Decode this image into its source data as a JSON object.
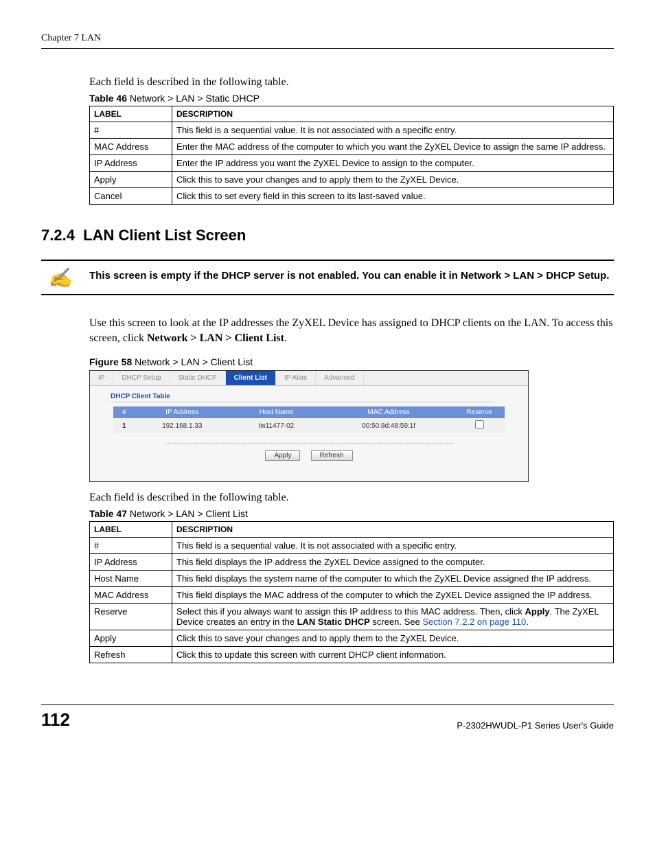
{
  "header": {
    "chapter": "Chapter 7 LAN"
  },
  "intro1": "Each field is described in the following table.",
  "table46": {
    "caption_bold": "Table 46",
    "caption_rest": "   Network > LAN > Static DHCP",
    "cols": {
      "label": "LABEL",
      "desc": "DESCRIPTION"
    },
    "rows": [
      {
        "label": "#",
        "desc": "This field is a sequential value. It is not associated with a specific entry."
      },
      {
        "label": "MAC Address",
        "desc": "Enter the MAC address of the computer to which you want the ZyXEL Device to assign the same IP address."
      },
      {
        "label": "IP Address",
        "desc": "Enter the IP address you want the ZyXEL Device to assign to the computer."
      },
      {
        "label": "Apply",
        "desc": "Click this to save your changes and to apply them to the ZyXEL Device."
      },
      {
        "label": "Cancel",
        "desc": "Click this to set every field in this screen to its last-saved value."
      }
    ]
  },
  "section": {
    "number": "7.2.4",
    "title": "LAN Client List Screen"
  },
  "note": {
    "icon": "✍",
    "text": "This screen is empty if the DHCP server is not enabled. You can enable it in Network > LAN > DHCP Setup."
  },
  "body": {
    "p1a": "Use this screen to look at the IP addresses the ZyXEL Device has assigned to DHCP clients on the LAN. To access this screen, click ",
    "p1b": "Network > LAN > Client List",
    "p1c": "."
  },
  "figure58": {
    "caption_bold": "Figure 58",
    "caption_rest": "   Network > LAN > Client List",
    "tabs": [
      "IP",
      "DHCP Setup",
      "Static DHCP",
      "Client List",
      "IP Alias",
      "Advanced"
    ],
    "active_tab": 3,
    "subhead": "DHCP Client Table",
    "cols": [
      "#",
      "IP Address",
      "Host Name",
      "MAC Address",
      "Reserve"
    ],
    "row": {
      "num": "1",
      "ip": "192.168.1.33",
      "host": "tw11477-02",
      "mac": "00:50:8d:48:59:1f"
    },
    "buttons": {
      "apply": "Apply",
      "refresh": "Refresh"
    }
  },
  "intro2": "Each field is described in the following table.",
  "table47": {
    "caption_bold": "Table 47",
    "caption_rest": "   Network > LAN > Client List",
    "cols": {
      "label": "LABEL",
      "desc": "DESCRIPTION"
    },
    "rows": [
      {
        "label": "#",
        "desc": "This field is a sequential value. It is not associated with a specific entry."
      },
      {
        "label": "IP Address",
        "desc": "This field displays the IP address the ZyXEL Device assigned to the computer."
      },
      {
        "label": "Host Name",
        "desc": "This field displays the system name of the computer to which the ZyXEL Device assigned the IP address."
      },
      {
        "label": "MAC Address",
        "desc": "This field displays the MAC address of the computer to which the ZyXEL Device assigned the IP address."
      }
    ],
    "reserve": {
      "label": "Reserve",
      "d1": "Select this if you always want to assign this IP address to this MAC address. Then, click ",
      "d2": "Apply",
      "d3": ". The ZyXEL Device creates an entry in the ",
      "d4": "LAN Static DHCP",
      "d5": " screen. See ",
      "link": "Section 7.2.2 on page 110",
      "d6": "."
    },
    "tail": [
      {
        "label": "Apply",
        "desc": "Click this to save your changes and to apply them to the ZyXEL Device."
      },
      {
        "label": "Refresh",
        "desc": "Click this to update this screen with current DHCP client information."
      }
    ]
  },
  "footer": {
    "page": "112",
    "guide": "P-2302HWUDL-P1 Series User's Guide"
  }
}
